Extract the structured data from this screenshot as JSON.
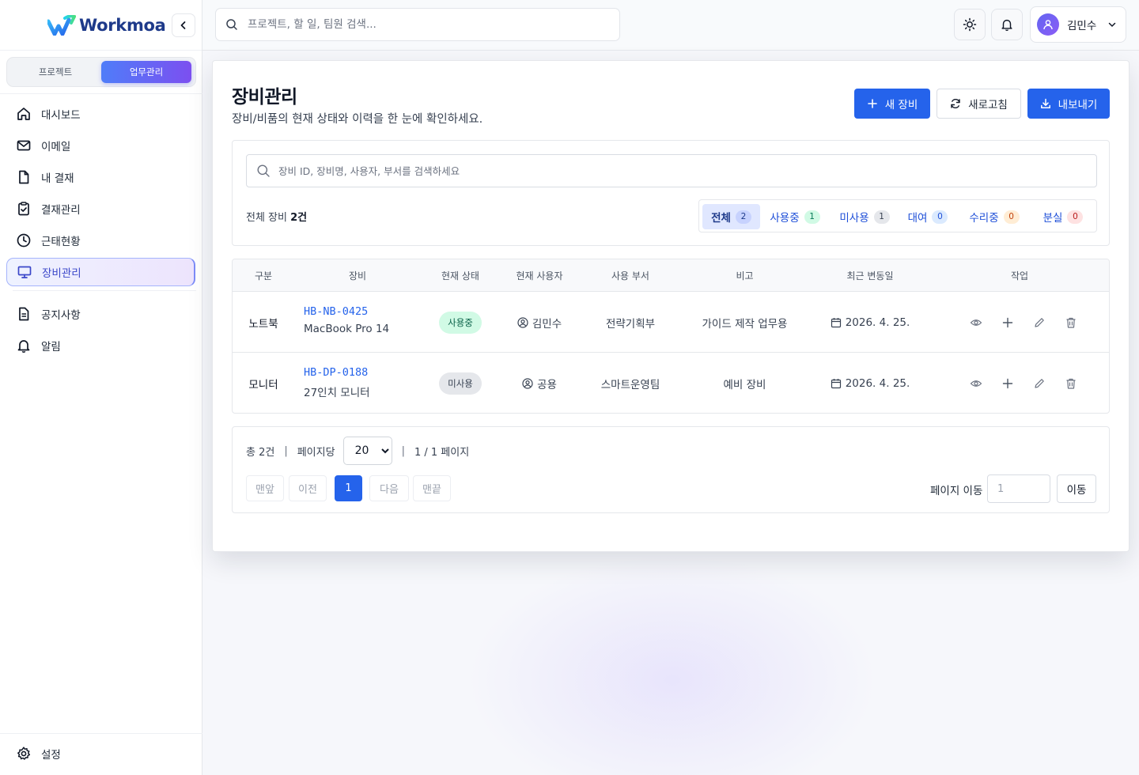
{
  "brand": {
    "name": "Workmoa"
  },
  "sidebar": {
    "segments": [
      "프로젝트",
      "업무관리"
    ],
    "items": [
      {
        "label": "대시보드",
        "icon": "home-icon"
      },
      {
        "label": "이메일",
        "icon": "mail-icon"
      },
      {
        "label": "내 결재",
        "icon": "file-icon"
      },
      {
        "label": "결재관리",
        "icon": "clipboard-check-icon"
      },
      {
        "label": "근태현황",
        "icon": "clock-icon"
      },
      {
        "label": "장비관리",
        "icon": "monitor-icon",
        "active": true
      },
      {
        "label": "공지사항",
        "icon": "document-icon"
      },
      {
        "label": "알림",
        "icon": "bell-icon"
      }
    ],
    "settings_label": "설정"
  },
  "topbar": {
    "search_placeholder": "프로젝트, 할 일, 팀원 검색...",
    "user_name": "김민수"
  },
  "page": {
    "title": "장비관리",
    "subtitle": "장비/비품의 현재 상태와 이력을 한 눈에 확인하세요.",
    "actions": {
      "new": "새 장비",
      "refresh": "새로고침",
      "export": "내보내기"
    }
  },
  "filter": {
    "search_placeholder": "장비 ID, 장비명, 사용자, 부서를 검색하세요",
    "total_label": "전체 장비",
    "total_value": "2건",
    "tabs": [
      {
        "label": "전체",
        "count": "2",
        "bg": "#c7d2fe",
        "fg": "#1e3a8a"
      },
      {
        "label": "사용중",
        "count": "1",
        "bg": "#d1fae5",
        "fg": "#047857"
      },
      {
        "label": "미사용",
        "count": "1",
        "bg": "#e5e7eb",
        "fg": "#374151"
      },
      {
        "label": "대여",
        "count": "0",
        "bg": "#dbeafe",
        "fg": "#1d4ed8"
      },
      {
        "label": "수리중",
        "count": "0",
        "bg": "#ffedd5",
        "fg": "#c2410c"
      },
      {
        "label": "분실",
        "count": "0",
        "bg": "#fee2e2",
        "fg": "#b91c1c"
      }
    ]
  },
  "table": {
    "headers": [
      "구분",
      "장비",
      "현재 상태",
      "현재 사용자",
      "사용 부서",
      "비고",
      "최근 변동일",
      "작업"
    ],
    "rows": [
      {
        "kind": "노트북",
        "id": "HB-NB-0425",
        "name": "MacBook Pro 14",
        "status": "사용중",
        "user": "김민수",
        "dept": "전략기획부",
        "note": "가이드 제작 업무용",
        "date": "2026. 4. 25."
      },
      {
        "kind": "모니터",
        "id": "HB-DP-0188",
        "name": "27인치 모니터",
        "status": "미사용",
        "user": "공용",
        "dept": "스마트운영팀",
        "note": "예비 장비",
        "date": "2026. 4. 25."
      }
    ]
  },
  "pagination": {
    "total": "총 2건",
    "per_page_label": "페이지당",
    "per_page_value": "20",
    "page_info": "1 / 1 페이지",
    "first": "맨앞",
    "prev": "이전",
    "current": "1",
    "next": "다음",
    "last": "맨끝",
    "jump_label": "페이지 이동",
    "jump_placeholder": "1",
    "jump_button": "이동"
  }
}
